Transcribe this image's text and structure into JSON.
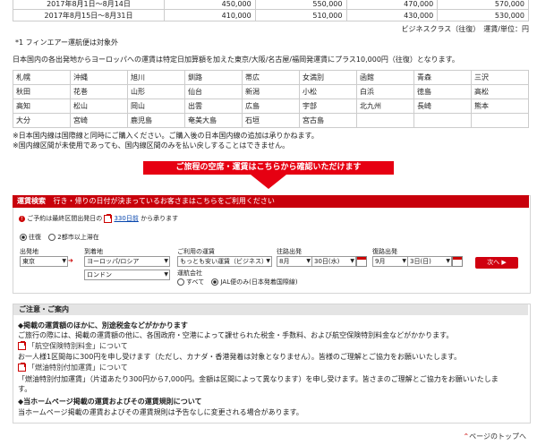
{
  "price_table": {
    "rows": [
      {
        "period": "2017年8月1日～8月14日",
        "c1": "450,000",
        "c2": "550,000",
        "c3": "470,000",
        "c4": "570,000"
      },
      {
        "period": "2017年8月15日～8月31日",
        "c1": "410,000",
        "c2": "510,000",
        "c3": "430,000",
        "c4": "530,000"
      }
    ],
    "unit_note": "ビジネスクラス（往復）　運賃/単位：円"
  },
  "footnote1": "*1 フィンエアー運航便は対象外",
  "domestic_note": "日本国内の各出発地からヨーロッパへの運賃は特定日加算額を加えた東京/大阪/名古屋/福岡発運賃にプラス10,000円（往復）となります。",
  "cities": [
    [
      "札幌",
      "沖縄",
      "旭川",
      "釧路",
      "帯広",
      "女満別",
      "函館",
      "青森",
      "三沢"
    ],
    [
      "秋田",
      "花巻",
      "山形",
      "仙台",
      "新潟",
      "小松",
      "白浜",
      "徳島",
      "高松"
    ],
    [
      "高知",
      "松山",
      "岡山",
      "出雲",
      "広島",
      "宇部",
      "北九州",
      "長崎",
      "熊本"
    ],
    [
      "大分",
      "宮崎",
      "鹿児島",
      "奄美大島",
      "石垣",
      "宮古島",
      "",
      "",
      ""
    ]
  ],
  "notes": [
    "※日本国内線は国際線と同時にご購入ください。ご購入後の日本国内線の追加は承りかねます。",
    "※国内線区間が未使用であっても、国内線区間のみを払い戻しすることはできません。"
  ],
  "banner_text": "ご旅程の空席・運賃はこちらから確認いただけます",
  "search": {
    "header_title": "運賃検索",
    "header_sub": "行き・帰りの日付が決まっているお客さまはこちらをご利用ください",
    "booking_prefix": "ご予約は最終区間出発日の",
    "booking_link": "330日前",
    "booking_suffix": "から承ります",
    "trip_roundtrip": "往復",
    "trip_multi": "2都市以上滞在",
    "origin_label": "出発地",
    "origin_value": "東京",
    "dest_label": "到着地",
    "dest_value": "ヨーロッパ/ロシア",
    "dest_city": "ロンドン",
    "fare_label": "ご利用の運賃",
    "fare_value": "もっとも安い運賃（ビジネス）",
    "outbound_label": "往路出発",
    "outbound_month": "8月",
    "outbound_day": "30日(水)",
    "return_label": "復路出発",
    "return_month": "9月",
    "return_day": "3日(日)",
    "next_button": "次へ",
    "carrier_label": "運航会社",
    "carrier_all": "すべて",
    "carrier_jal": "JAL便のみ(日本発着国際線)"
  },
  "notice": {
    "title": "ご注意・ご案内",
    "h1": "◆掲載の運賃額のほかに、別途税金などがかかります",
    "p1": "ご旅行の際には、掲載の運賃額の他に、各国政府・空港によって課せられた税金・手数料、および航空保険特別料金などがかかります。",
    "link1": "「航空保険特別料金」について",
    "p2": "お一人様1区間毎に300円を申し受けます（ただし、カナダ・香港発着は対象となりません）。皆様のご理解とご協力をお願いいたします。",
    "link2": "「燃油特別付加運賃」について",
    "p3a": "「燃油特別付加運賃」（片道あたり300円から7,000円。金額は区間によって異なります）を申し受けます。皆さまのご理解とご協力をお願いいたしま",
    "p3b": "す。",
    "h2": "◆当ホームページ掲載の運賃およびその運賃規則について",
    "p4": "当ホームページ掲載の運賃およびその運賃規則は予告なしに変更される場合があります。"
  },
  "page_top": "ページのトップへ"
}
